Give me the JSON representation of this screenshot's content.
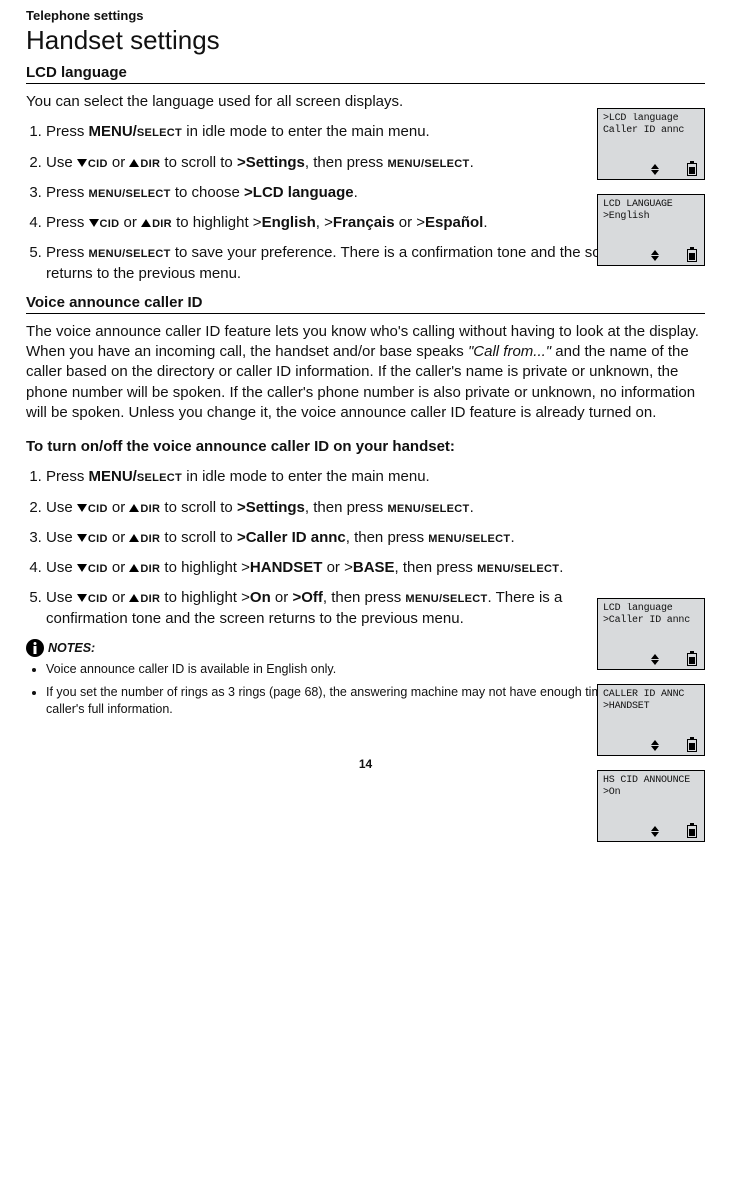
{
  "breadcrumb": "Telephone settings",
  "page_title": "Handset settings",
  "section1": {
    "heading": "LCD language",
    "intro": "You can select the language used for all screen displays.",
    "steps": [
      {
        "prefix": "Press ",
        "b1": "MENU/",
        "sc1": "SELECT",
        "suffix": " in idle mode to enter the main menu."
      },
      {
        "prefix": "Use ",
        "cid": "CID",
        "mid": " or ",
        "dir": "DIR",
        "mid2": " to scroll to ",
        "target": ">Settings",
        "mid3": ", then press ",
        "scbtn": "MENU/SELECT",
        "suffix2": "."
      },
      {
        "prefix": "Press ",
        "scbtn": "MENU/SELECT",
        "mid": " to choose ",
        "target": ">LCD language",
        "suffix": "."
      },
      {
        "prefix": "Press ",
        "cid": "CID",
        "mid": " or ",
        "dir": "DIR",
        "mid2": " to highlight >",
        "opt1": "English",
        "c1": ", >",
        "opt2": "Français",
        "c2": " or >",
        "opt3": "Español",
        "suffix": "."
      },
      {
        "prefix": "Press ",
        "scbtn": "MENU/SELECT",
        "suffix": " to save your preference. There is a confirmation tone and the screen returns to the previous menu."
      }
    ]
  },
  "section2": {
    "heading": "Voice announce caller ID",
    "intro_a": "The voice announce caller ID feature lets you know who's calling without having to look at the display. When you have an incoming call, the handset and/or base speaks ",
    "intro_quote": "\"Call from...\"",
    "intro_b": " and the name of the caller based on the directory or caller ID information. If the caller's name is private or unknown, the phone number will be spoken. If the caller's phone number is also private or unknown, no information will be spoken. Unless you change it, the voice announce caller ID feature is already turned on.",
    "subhead2": "To turn on/off the voice announce caller ID on your handset:",
    "steps": [
      {
        "prefix": "Press ",
        "b1": "MENU/",
        "sc1": "SELECT",
        "suffix": " in idle mode to enter the main menu."
      },
      {
        "prefix": "Use ",
        "cid": "CID",
        "mid": " or ",
        "dir": "DIR",
        "mid2": " to scroll to ",
        "target": ">Settings",
        "mid3": ", then press ",
        "scbtn": "MENU/SELECT",
        "suffix2": "."
      },
      {
        "prefix": "Use ",
        "cid": "CID",
        "mid": " or ",
        "dir": "DIR",
        "mid2": " to scroll to ",
        "target": ">Caller ID annc",
        "mid3": ", then press ",
        "scbtn": "MENU/SELECT",
        "suffix2": "."
      },
      {
        "prefix": "Use ",
        "cid": "CID",
        "mid": " or ",
        "dir": "DIR",
        "mid2": " to highlight >",
        "opt1": "HANDSET",
        "c1": " or >",
        "opt2": "BASE",
        "mid3": ", then press ",
        "scbtn": "MENU/SELECT",
        "suffix2": "."
      },
      {
        "prefix": "Use ",
        "cid": "CID",
        "mid": " or ",
        "dir": "DIR",
        "mid2": " to highlight >",
        "opt1": "On",
        "c1": " or ",
        "optb": ">Off",
        "mid3": ", then press ",
        "scbtn": "MENU/SELECT",
        "suffix2": ". There is a confirmation tone and the screen returns to the previous menu."
      }
    ]
  },
  "notes": {
    "label": "NOTES:",
    "items": [
      "Voice announce caller ID is available in English only.",
      "If you set the number of rings as 3 rings (page 68), the answering machine may not have enough time to announce the caller's full information."
    ]
  },
  "screens_top": [
    {
      "l1": ">LCD language",
      "l2": " Caller ID annc"
    },
    {
      "l1": "  LCD LANGUAGE",
      "l2": ">English"
    }
  ],
  "screens_mid": [
    {
      "l1": " LCD language",
      "l2": ">Caller ID annc"
    },
    {
      "l1": " CALLER ID ANNC",
      "l2": ">HANDSET"
    },
    {
      "l1": " HS CID ANNOUNCE",
      "l2": ">On"
    }
  ],
  "page_number": "14"
}
